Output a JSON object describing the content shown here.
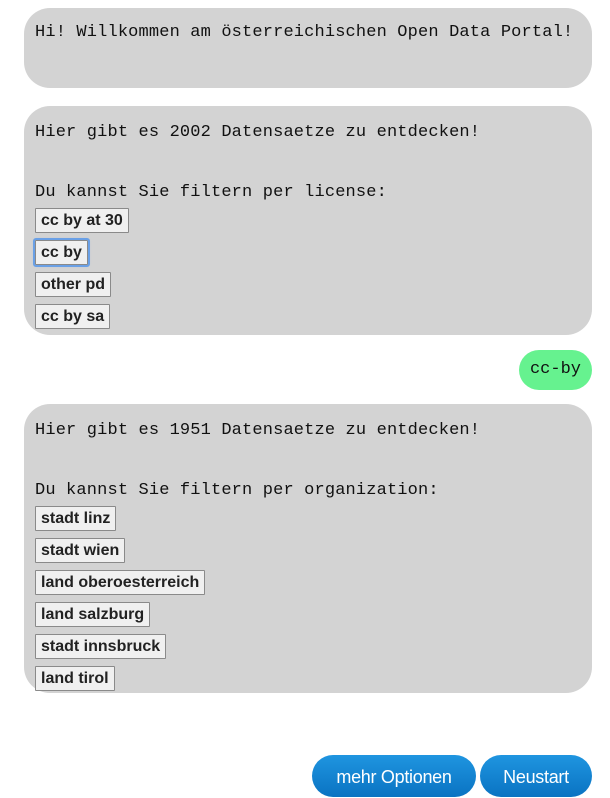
{
  "welcome": {
    "text": "Hi! Willkommen am österreichischen Open Data Portal!"
  },
  "filter_license": {
    "count_text": "Hier gibt es 2002 Datensaetze zu entdecken!",
    "prompt": "Du kannst Sie filtern per license:",
    "options": [
      "cc by at 30",
      "cc by",
      "other pd",
      "cc by sa"
    ],
    "focused_option": "cc by"
  },
  "user_reply": {
    "text": "cc-by",
    "color": "#66f28f"
  },
  "filter_organization": {
    "count_text": "Hier gibt es 1951 Datensaetze zu entdecken!",
    "prompt": "Du kannst Sie filtern per organization:",
    "options": [
      "stadt linz",
      "stadt wien",
      "land oberoesterreich",
      "land salzburg",
      "stadt innsbruck",
      "land tirol"
    ]
  },
  "actions": {
    "more_options_label": "mehr Optionen",
    "restart_label": "Neustart",
    "accent_color": "#0a80d0"
  },
  "colors": {
    "bot_bubble": "#d3d3d3",
    "user_bubble": "#66f28f",
    "focus_ring": "#6aa0e6"
  }
}
